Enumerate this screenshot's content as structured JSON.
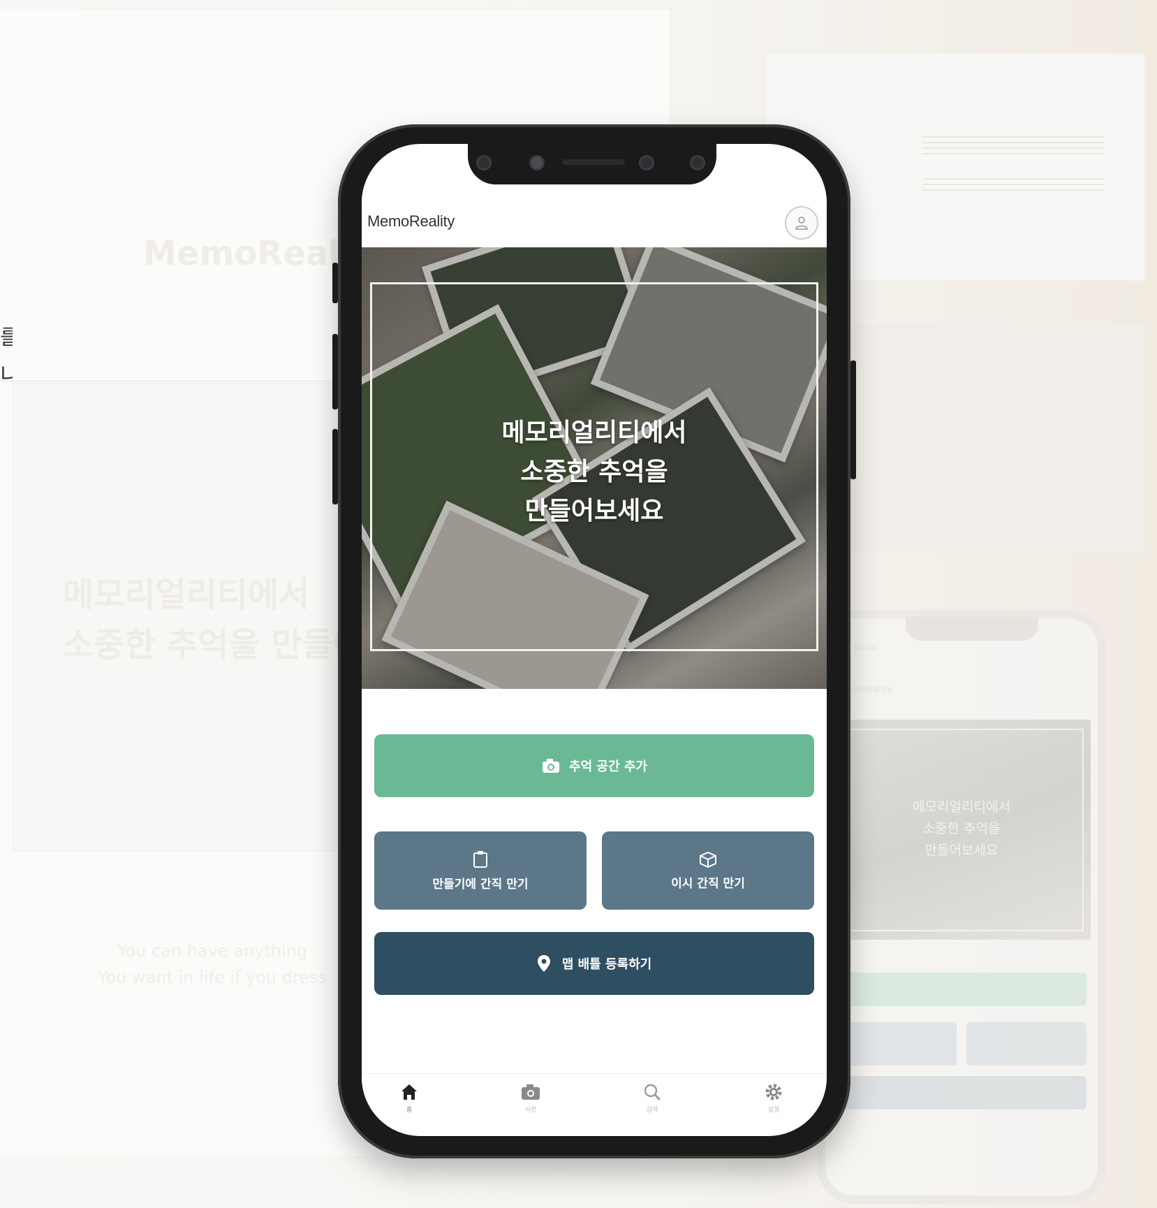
{
  "background": {
    "brand": "MemoReality",
    "headline": "메모리얼리티에서\n소중한 추억을 만들어",
    "tagline": "You can have anything\nYou want in life if you dress",
    "edge_line_1": "를",
    "edge_line_2": "니"
  },
  "ghost_phone": {
    "time": "10:00",
    "brand": "MemoReality",
    "headline": "메모리얼리티에서\n소중한 추억을\n만들어보세요"
  },
  "app": {
    "brand": "MemoReality",
    "profile_icon": "user-icon",
    "hero_headline": "메모리얼리티에서\n소중한 추억을\n만들어보세요",
    "buttons": {
      "add_memory_space": "추억 공간 추가",
      "photo_detail": "만들기에 간직 만기",
      "this_time": "이시 간직 만기",
      "register_location": "맵 배틀 등록하기"
    },
    "tabs": [
      {
        "icon": "home-icon",
        "label": "홈"
      },
      {
        "icon": "camera-icon",
        "label": "사진"
      },
      {
        "icon": "search-icon",
        "label": "검색"
      },
      {
        "icon": "gear-icon",
        "label": "설정"
      }
    ]
  },
  "colors": {
    "primary_green": "#6ab894",
    "slate_blue": "#5b7788",
    "dark_navy": "#2e4e62"
  }
}
